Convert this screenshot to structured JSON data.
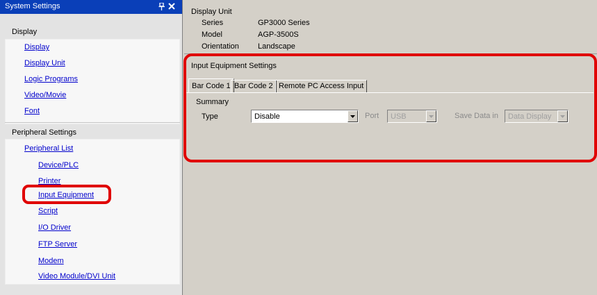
{
  "panel": {
    "title": "System Settings"
  },
  "sidebar": {
    "display_group": "Display",
    "display_links": [
      "Display",
      "Display Unit",
      "Logic Programs",
      "Video/Movie",
      "Font"
    ],
    "peripheral_group": "Peripheral Settings",
    "peripheral_list": "Peripheral List",
    "peripheral_links": [
      "Device/PLC",
      "Printer",
      "Input Equipment",
      "Script",
      "I/O Driver",
      "FTP Server",
      "Modem",
      "Video Module/DVI Unit"
    ]
  },
  "display_unit": {
    "title": "Display Unit",
    "rows": [
      {
        "label": "Series",
        "value": "GP3000 Series"
      },
      {
        "label": "Model",
        "value": "AGP-3500S"
      },
      {
        "label": "Orientation",
        "value": "Landscape"
      }
    ]
  },
  "input_equipment": {
    "title": "Input Equipment Settings",
    "tabs": [
      "Bar Code 1",
      "Bar Code 2",
      "Remote PC Access Input"
    ],
    "summary": "Summary",
    "type_label": "Type",
    "type_value": "Disable",
    "port_label": "Port",
    "port_value": "USB",
    "save_label": "Save Data in",
    "save_value": "Data Display"
  },
  "colors": {
    "title_bar": "#0a3fb8",
    "link": "#0000cc",
    "highlight": "#e00000"
  }
}
